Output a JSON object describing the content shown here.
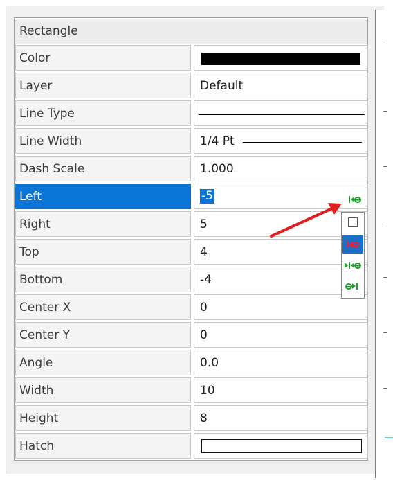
{
  "panel": {
    "header": "Rectangle",
    "rows": [
      {
        "label": "Color",
        "kind": "swatch",
        "value": "",
        "color": "#000000"
      },
      {
        "label": "Layer",
        "kind": "text",
        "value": "Default"
      },
      {
        "label": "Line Type",
        "kind": "line",
        "value": ""
      },
      {
        "label": "Line Width",
        "kind": "text-line",
        "value": "1/4 Pt"
      },
      {
        "label": "Dash Scale",
        "kind": "text",
        "value": "1.000"
      },
      {
        "label": "Left",
        "kind": "selected",
        "value": "-5"
      },
      {
        "label": "Right",
        "kind": "text",
        "value": "5"
      },
      {
        "label": "Top",
        "kind": "text",
        "value": "4"
      },
      {
        "label": "Bottom",
        "kind": "text",
        "value": "-4"
      },
      {
        "label": "Center X",
        "kind": "text",
        "value": "0"
      },
      {
        "label": "Center Y",
        "kind": "text",
        "value": "0"
      },
      {
        "label": "Angle",
        "kind": "text",
        "value": "0.0"
      },
      {
        "label": "Width",
        "kind": "text",
        "value": "10"
      },
      {
        "label": "Height",
        "kind": "text",
        "value": "8"
      },
      {
        "label": "Hatch",
        "kind": "hatch",
        "value": ""
      }
    ]
  },
  "snap_menu": {
    "button_icon": "snap-left-icon",
    "items": [
      {
        "icon": "checkbox-empty-icon",
        "highlighted": false
      },
      {
        "icon": "snap-left-icon",
        "highlighted": true
      },
      {
        "icon": "snap-center-icon",
        "highlighted": false
      },
      {
        "icon": "snap-right-icon",
        "highlighted": false
      }
    ]
  },
  "colors": {
    "selection": "#0a74d7",
    "snap_icon_green": "#1aa32a",
    "snap_icon_red": "#e0223a",
    "annotation_arrow": "#e02020"
  }
}
